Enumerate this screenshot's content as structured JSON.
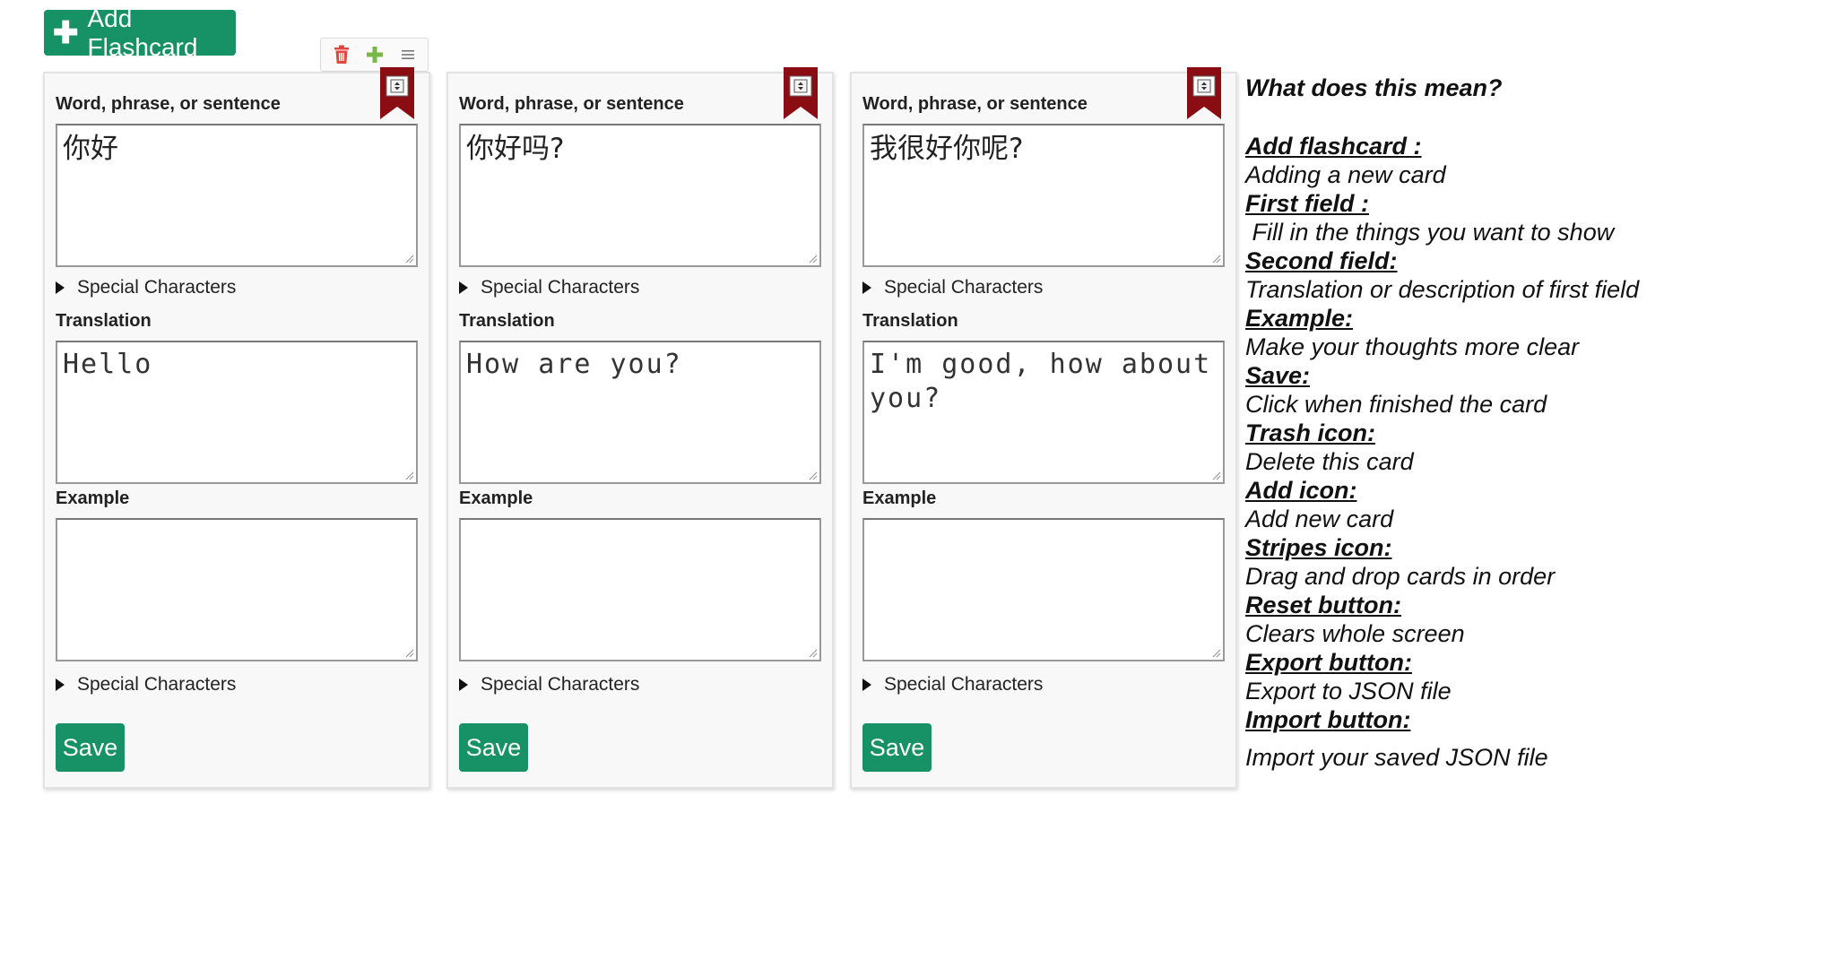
{
  "header": {
    "add_flashcard_label": "Add Flashcard"
  },
  "toolbar": {
    "icons": [
      "trash-icon",
      "plus-icon",
      "stripes-icon"
    ],
    "colors": {
      "trash": "#e0473d",
      "plus": "#7ab648",
      "stripes": "#777777"
    }
  },
  "colors": {
    "primary_button": "#179166",
    "ribbon": "#8b0d14",
    "card_bg": "#f8f8f8"
  },
  "cards": [
    {
      "word_label": "Word, phrase, or sentence",
      "word_value": "你好",
      "special_characters_label": "Special Characters",
      "translation_label": "Translation",
      "translation_value": "Hello",
      "example_label": "Example",
      "example_value": "",
      "special_characters_label_2": "Special Characters",
      "save_label": "Save"
    },
    {
      "word_label": "Word, phrase, or sentence",
      "word_value": "你好吗?",
      "special_characters_label": "Special Characters",
      "translation_label": "Translation",
      "translation_value": "How are you?",
      "example_label": "Example",
      "example_value": "",
      "special_characters_label_2": "Special Characters",
      "save_label": "Save"
    },
    {
      "word_label": "Word, phrase, or sentence",
      "word_value": "我很好你呢?",
      "special_characters_label": "Special Characters",
      "translation_label": "Translation",
      "translation_value": "I'm good, how about you?",
      "example_label": "Example",
      "example_value": "",
      "special_characters_label_2": "Special Characters",
      "save_label": "Save"
    }
  ],
  "help": {
    "title": "What does this mean?",
    "items": [
      {
        "term": "Add flashcard :",
        "desc": "Adding a new card"
      },
      {
        "term": "First field :",
        "desc": " Fill in the things you want to show"
      },
      {
        "term": "Second field:",
        "desc": "Translation or description of first field"
      },
      {
        "term": "Example:",
        "desc": "Make your thoughts more clear"
      },
      {
        "term": "Save:",
        "desc": "Click when finished the card"
      },
      {
        "term": "Trash icon:",
        "desc": "Delete this card"
      },
      {
        "term": "Add icon:",
        "desc": "Add new card"
      },
      {
        "term": "Stripes icon:",
        "desc": "Drag and drop cards in order"
      },
      {
        "term": "Reset button:",
        "desc": "Clears whole screen"
      },
      {
        "term": "Export button:",
        "desc": "Export to JSON file"
      },
      {
        "term": "Import button:",
        "desc": "Import your saved JSON file"
      }
    ]
  }
}
